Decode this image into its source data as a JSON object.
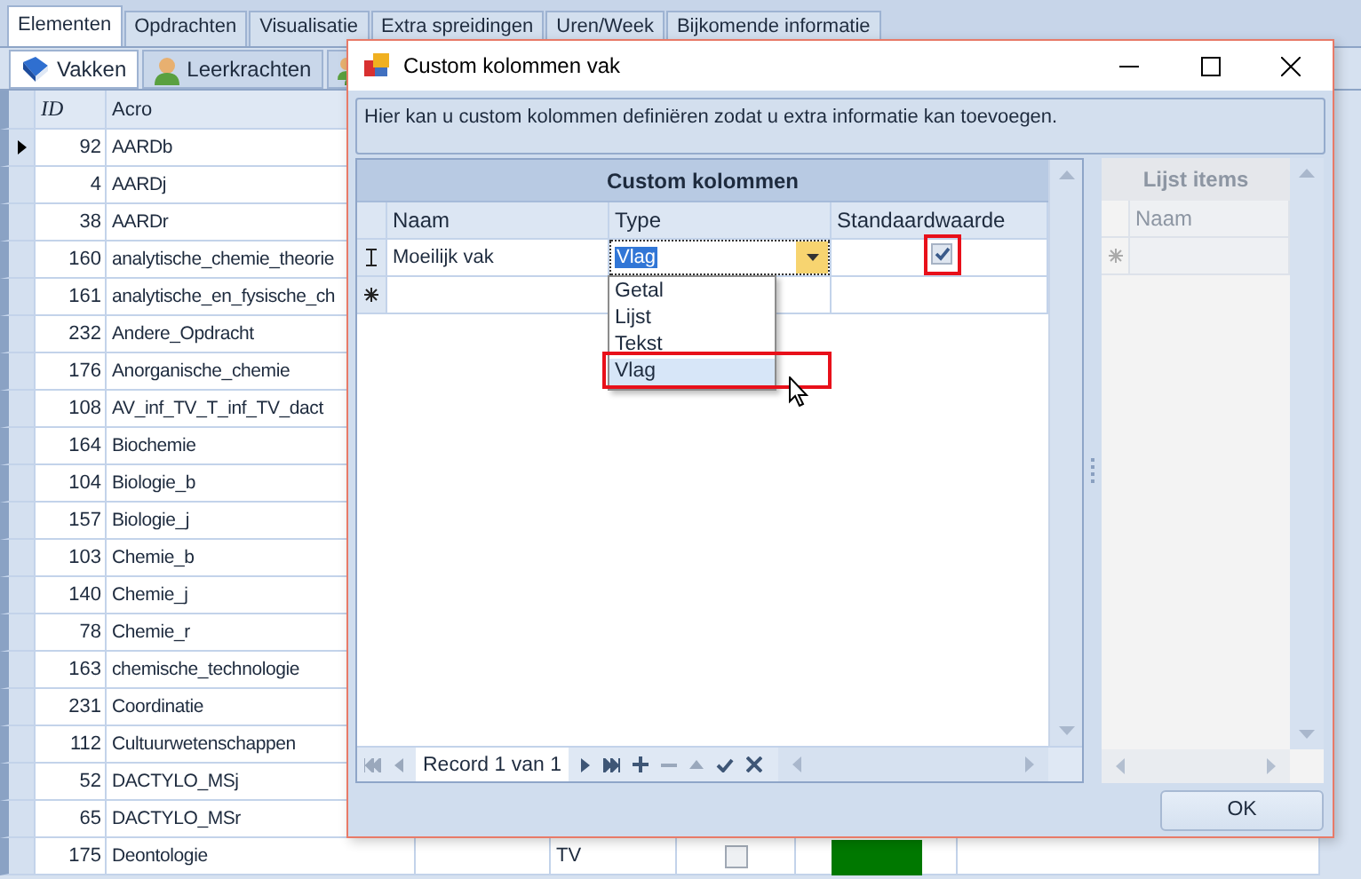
{
  "main_tabs": [
    {
      "label": "Elementen",
      "selected": true
    },
    {
      "label": "Opdrachten",
      "selected": false
    },
    {
      "label": "Visualisatie",
      "selected": false
    },
    {
      "label": "Extra spreidingen",
      "selected": false
    },
    {
      "label": "Uren/Week",
      "selected": false
    },
    {
      "label": "Bijkomende informatie",
      "selected": false
    }
  ],
  "sub_tabs": [
    {
      "label": "Vakken",
      "selected": true
    },
    {
      "label": "Leerkrachten",
      "selected": false
    },
    {
      "selected": false
    }
  ],
  "table": {
    "columns": [
      "ID",
      "Acro"
    ],
    "rows": [
      {
        "id": "92",
        "acro": "AARDb",
        "selected": true
      },
      {
        "id": "4",
        "acro": "AARDj",
        "selected": false
      },
      {
        "id": "38",
        "acro": "AARDr",
        "selected": false
      },
      {
        "id": "160",
        "acro": "analytische_chemie_theorie",
        "selected": false
      },
      {
        "id": "161",
        "acro": "analytische_en_fysische_ch",
        "selected": false
      },
      {
        "id": "232",
        "acro": "Andere_Opdracht",
        "selected": false
      },
      {
        "id": "176",
        "acro": "Anorganische_chemie",
        "selected": false
      },
      {
        "id": "108",
        "acro": "AV_inf_TV_T_inf_TV_dact",
        "selected": false
      },
      {
        "id": "164",
        "acro": "Biochemie",
        "selected": false
      },
      {
        "id": "104",
        "acro": "Biologie_b",
        "selected": false
      },
      {
        "id": "157",
        "acro": "Biologie_j",
        "selected": false
      },
      {
        "id": "103",
        "acro": "Chemie_b",
        "selected": false
      },
      {
        "id": "140",
        "acro": "Chemie_j",
        "selected": false
      },
      {
        "id": "78",
        "acro": "Chemie_r",
        "selected": false
      },
      {
        "id": "163",
        "acro": "chemische_technologie",
        "selected": false
      },
      {
        "id": "231",
        "acro": "Coordinatie",
        "selected": false
      },
      {
        "id": "112",
        "acro": "Cultuurwetenschappen",
        "selected": false
      },
      {
        "id": "52",
        "acro": "DACTYLO_MSj",
        "selected": false
      },
      {
        "id": "65",
        "acro": "DACTYLO_MSr",
        "selected": false
      },
      {
        "id": "175",
        "acro": "Deontologie",
        "selected": false,
        "column_5": "TV",
        "checked": false,
        "color": "#007800"
      }
    ]
  },
  "dialog": {
    "title": "Custom kolommen vak",
    "info_text": "Hier kan u custom kolommen definiëren zodat u extra informatie kan toevoegen.",
    "grid": {
      "title": "Custom kolommen",
      "columns": [
        "Naam",
        "Type",
        "Standaardwaarde"
      ],
      "rows": [
        {
          "naam": "Moeilijk vak",
          "type": "Vlag",
          "checked": true,
          "highlighted": true
        }
      ]
    },
    "dropdown": {
      "options": [
        {
          "label": "Getal",
          "selected": false,
          "highlighted": false
        },
        {
          "label": "Lijst",
          "selected": false,
          "highlighted": false
        },
        {
          "label": "Tekst",
          "selected": false,
          "highlighted": false
        },
        {
          "label": "Vlag",
          "selected": true,
          "highlighted": true
        }
      ]
    },
    "navigator": {
      "record_text": "Record 1 van 1"
    },
    "side_grid": {
      "title": "Lijst items",
      "columns": [
        "Naam"
      ],
      "disabled": true
    },
    "ok_button": "OK"
  }
}
